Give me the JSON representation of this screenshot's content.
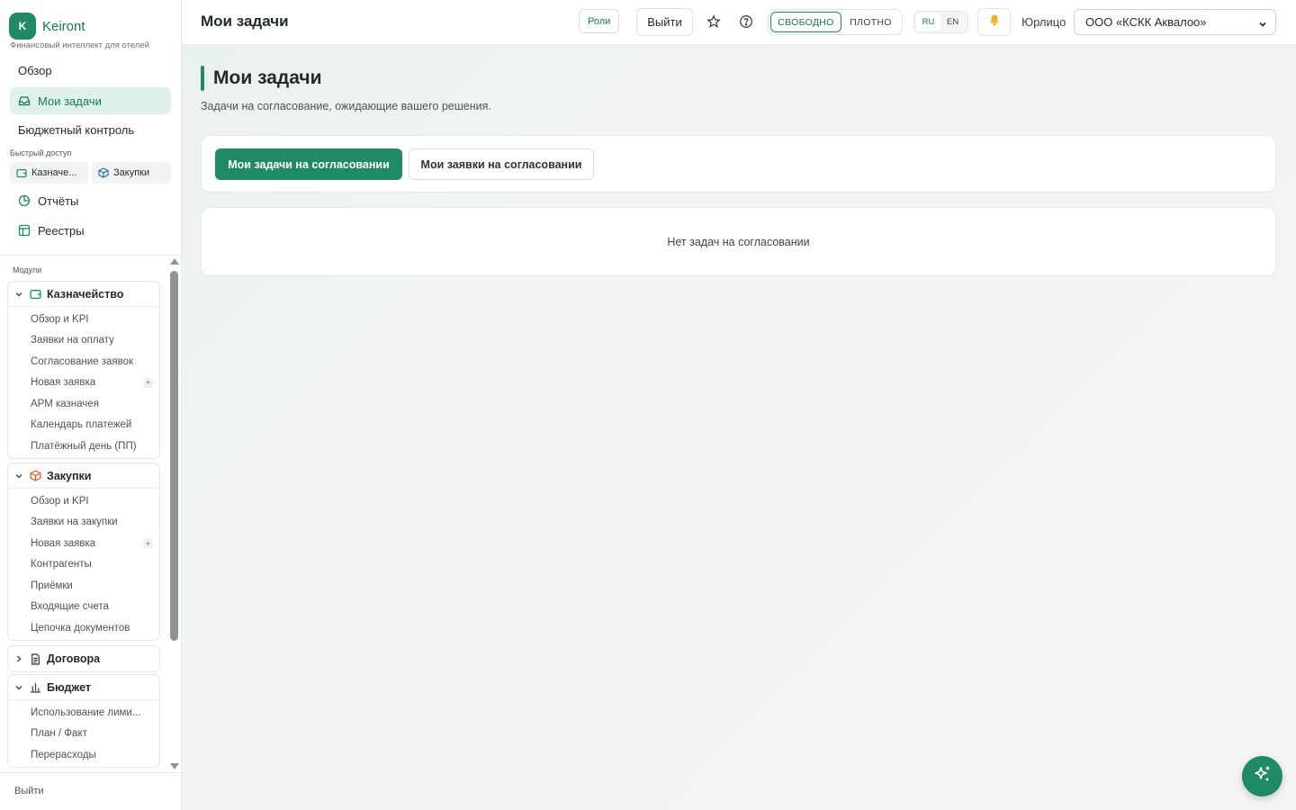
{
  "brand": {
    "logo_letter": "K",
    "name": "Keiront",
    "subtitle": "Финансовый интеллект для отелей"
  },
  "nav": {
    "overview": "Обзор",
    "my_tasks": "Мои задачи",
    "budget_control": "Бюджетный контроль",
    "quick_access_label": "Быстрый доступ",
    "quick": [
      "Казначе...",
      "Закупки"
    ],
    "reports": "Отчёты",
    "registries": "Реестры"
  },
  "modules": {
    "label": "Модули",
    "treasury": {
      "title": "Казначейство",
      "items": [
        "Обзор и KPI",
        "Заявки на оплату",
        "Согласование заявок",
        "Новая заявка",
        "АРМ казначея",
        "Календарь платежей",
        "Платёжный день (ПП)"
      ]
    },
    "purchases": {
      "title": "Закупки",
      "items": [
        "Обзор и KPI",
        "Заявки на закупки",
        "Новая заявка",
        "Контрагенты",
        "Приёмки",
        "Входящие счета",
        "Цепочка документов"
      ]
    },
    "contracts": {
      "title": "Договора"
    },
    "budget": {
      "title": "Бюджет",
      "items": [
        "Использование лими...",
        "План / Факт",
        "Перерасходы"
      ]
    },
    "plus_glyph": "+"
  },
  "sidebar_footer": {
    "logout": "Выйти"
  },
  "topbar": {
    "title": "Мои задачи",
    "roles": "Роли",
    "logout": "Выйти",
    "density": {
      "free": "СВОБОДНО",
      "dense": "ПЛОТНО"
    },
    "lang": {
      "ru": "RU",
      "en": "EN"
    },
    "entity_label": "Юрлицо",
    "entity_value": "ООО «КСКК Аквалоо»"
  },
  "main": {
    "title": "Мои задачи",
    "subtitle": "Задачи на согласование, ожидающие вашего решения.",
    "tabs": [
      "Мои задачи на согласовании",
      "Мои заявки на согласовании"
    ],
    "empty": "Нет задач на согласовании"
  },
  "colors": {
    "accent": "#1f8a63",
    "accent_text": "#157a55",
    "active_bg": "#dff1e9"
  }
}
